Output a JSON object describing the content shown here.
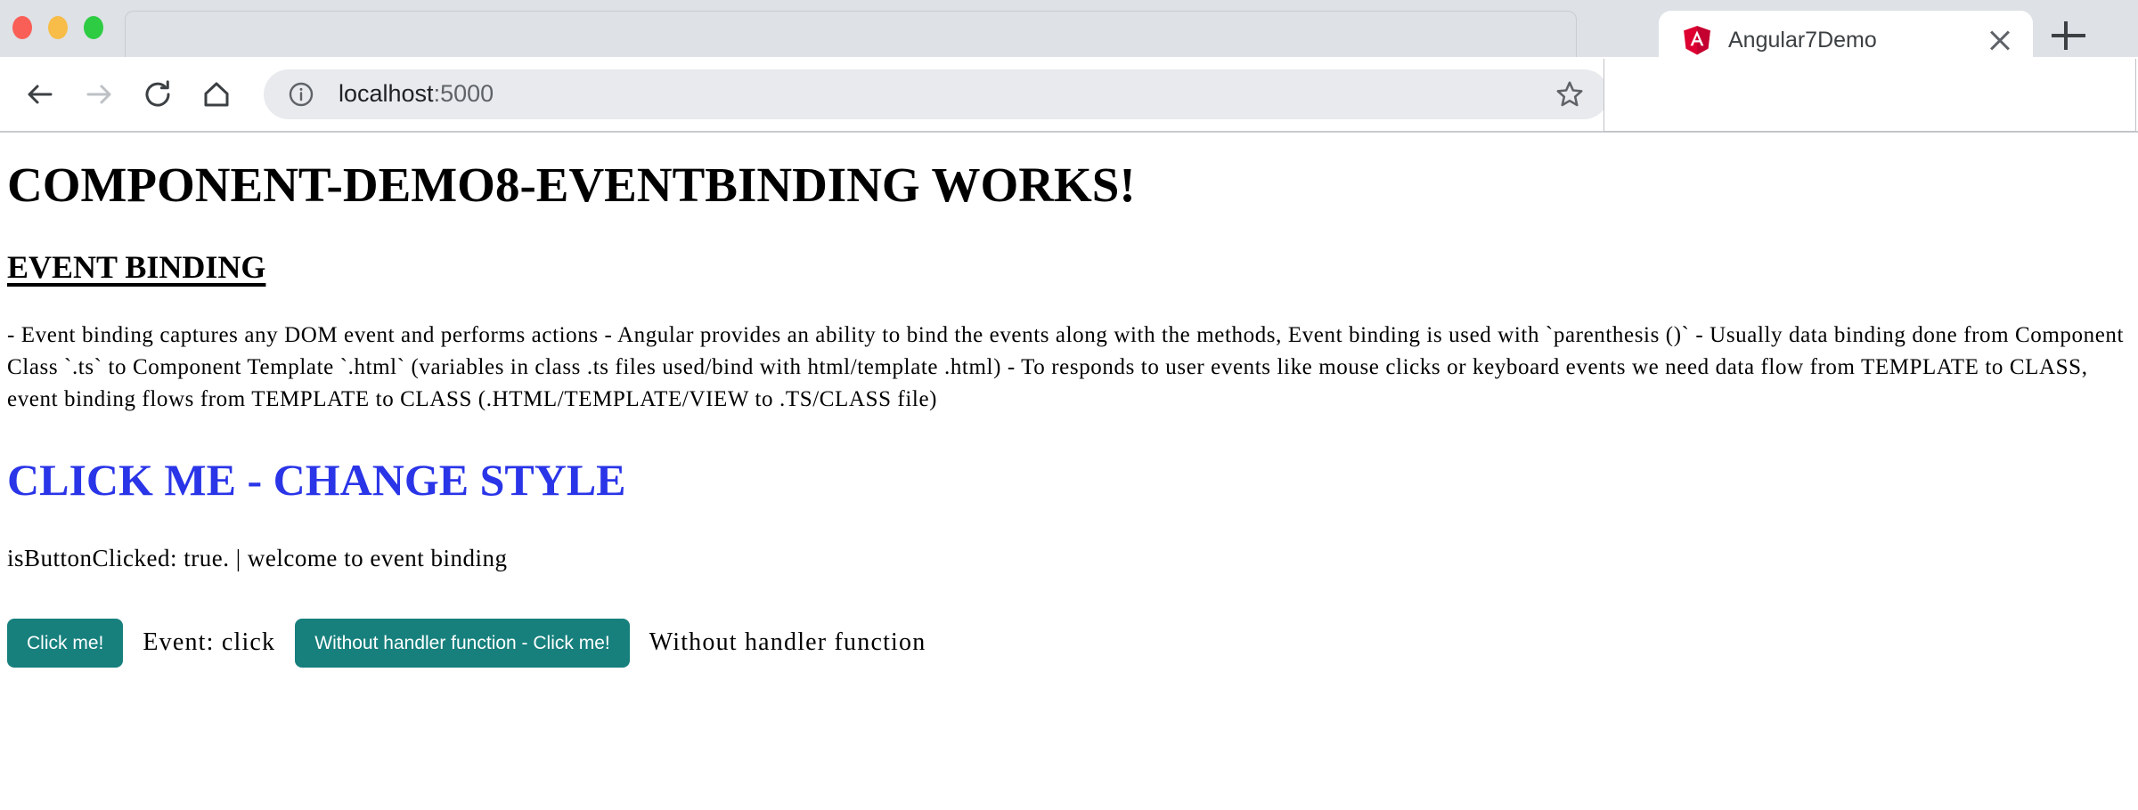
{
  "browser": {
    "window_controls": [
      {
        "name": "close",
        "color": "#fa5f57"
      },
      {
        "name": "minimize",
        "color": "#f7bd48"
      },
      {
        "name": "maximize",
        "color": "#2dcc43"
      }
    ],
    "tab": {
      "title": "Angular7Demo",
      "favicon": "angular-logo-icon",
      "close_label": "×"
    },
    "new_tab_label": "+",
    "toolbar": {
      "back_icon": "back-arrow-icon",
      "forward_icon": "forward-arrow-icon",
      "reload_icon": "reload-icon",
      "home_icon": "home-icon",
      "info_icon": "info-circle-icon",
      "bookmark_icon": "star-outline-icon",
      "url_host": "localhost",
      "url_port": ":5000"
    }
  },
  "page": {
    "app_title": "component-demo8-eventbinding works!",
    "section_title": "Event Binding",
    "description": "- Event binding captures any DOM event and performs actions - Angular provides an ability to bind the events along with the methods, Event binding is used with `parenthesis ()` - Usually data binding done from Component Class `.ts` to Component Template `.html` (variables in class .ts files used/bind with html/template .html) - To responds to user events like mouse clicks or keyboard events we need data flow from TEMPLATE to CLASS, event binding flows from TEMPLATE to CLASS (.HTML/TEMPLATE/VIEW to .TS/CLASS file)",
    "click_heading": "Click me - change style",
    "click_heading_color": "#2a35e8",
    "status_line": "isButtonClicked: true. | welcome to event binding",
    "buttons": {
      "primary_label": "Click me!",
      "primary_caption": "Event: click",
      "secondary_label": "Without handler function - Click me!",
      "secondary_caption": "Without handler function",
      "accent_color": "#17807d"
    }
  }
}
